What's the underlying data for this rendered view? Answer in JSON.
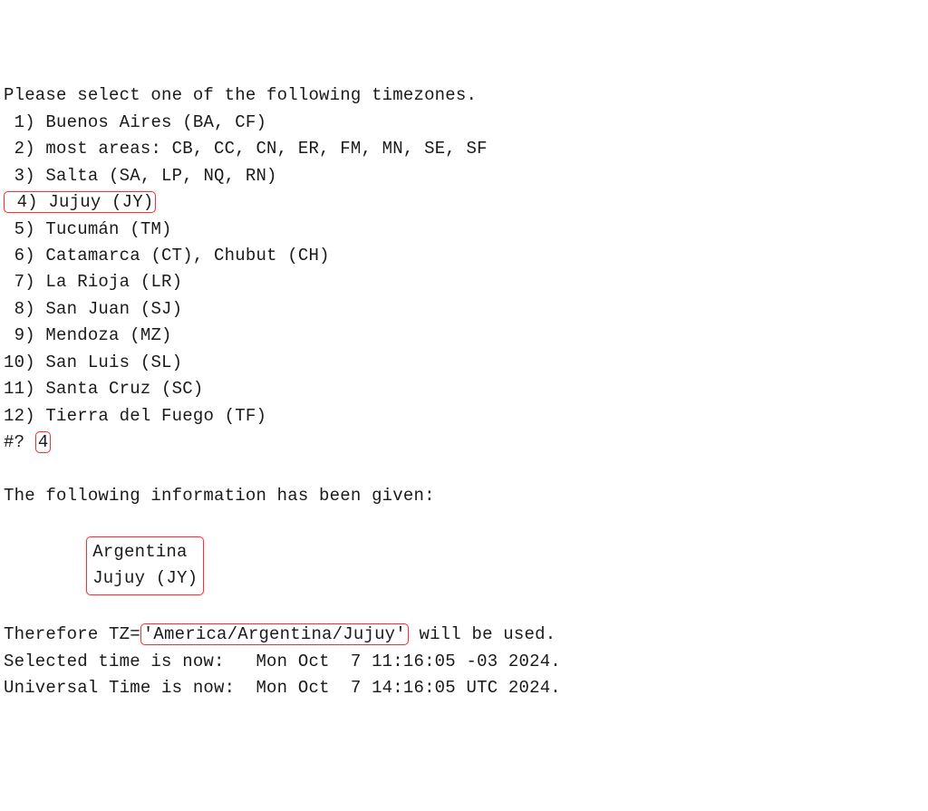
{
  "prompt_header": "Please select one of the following timezones.",
  "options": [
    {
      "num": " 1",
      "label": "Buenos Aires (BA, CF)"
    },
    {
      "num": " 2",
      "label": "most areas: CB, CC, CN, ER, FM, MN, SE, SF"
    },
    {
      "num": " 3",
      "label": "Salta (SA, LP, NQ, RN)"
    },
    {
      "num": " 4",
      "label": "Jujuy (JY)"
    },
    {
      "num": " 5",
      "label": "Tucumán (TM)"
    },
    {
      "num": " 6",
      "label": "Catamarca (CT), Chubut (CH)"
    },
    {
      "num": " 7",
      "label": "La Rioja (LR)"
    },
    {
      "num": " 8",
      "label": "San Juan (SJ)"
    },
    {
      "num": " 9",
      "label": "Mendoza (MZ)"
    },
    {
      "num": "10",
      "label": "San Luis (SL)"
    },
    {
      "num": "11",
      "label": "Santa Cruz (SC)"
    },
    {
      "num": "12",
      "label": "Tierra del Fuego (TF)"
    }
  ],
  "highlighted_option_index": 3,
  "input_prompt": "#? ",
  "user_input": "4",
  "info_header": "The following information has been given:",
  "info_lines": [
    "Argentina",
    "Jujuy (JY)"
  ],
  "tz_prefix": "Therefore TZ=",
  "tz_value": "'America/Argentina/Jujuy'",
  "tz_suffix": " will be used.",
  "selected_time_label": "Selected time is now:   ",
  "selected_time_value": "Mon Oct  7 11:16:05 -03 2024.",
  "utc_time_label": "Universal Time is now:  ",
  "utc_time_value": "Mon Oct  7 14:16:05 UTC 2024."
}
